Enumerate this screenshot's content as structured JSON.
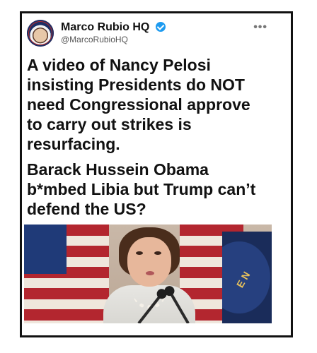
{
  "post": {
    "author_name": "Marco Rubio HQ",
    "author_handle": "@MarcoRubioHQ",
    "more_label": "•••",
    "text_1": "A video of Nancy Pelosi insisting Presidents do NOT need Congressional approve to carry out strikes is resurfacing.",
    "text_2": "Barack Hussein Obama b*mbed Libia but Trump can’t defend the US?"
  },
  "image": {
    "seal_text": "E N"
  },
  "icons": {
    "verified": "verified-badge-icon",
    "more": "more-options-icon"
  },
  "colors": {
    "verified_blue": "#1d9bf0",
    "text": "#111111"
  }
}
